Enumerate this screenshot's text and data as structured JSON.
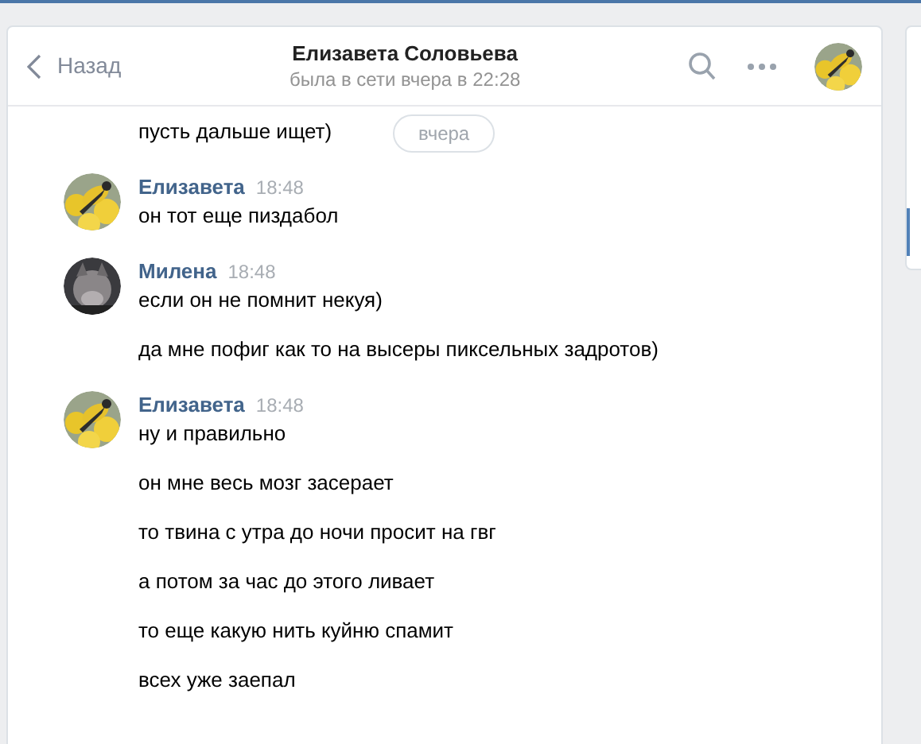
{
  "header": {
    "back": "Назад",
    "title": "Елизавета Соловьева",
    "status": "была в сети вчера в 22:28",
    "avatar": {
      "kind": "picture"
    }
  },
  "continued_messages": [
    "пусть дальше ищет)"
  ],
  "date_divider": "вчера",
  "groups": [
    {
      "sender": "Елизавета",
      "time": "18:48",
      "avatar": {
        "kind": "picture"
      },
      "messages": [
        "он тот еще пиздабол"
      ]
    },
    {
      "sender": "Милена",
      "time": "18:48",
      "avatar": {
        "kind": "picture"
      },
      "messages": [
        "если он не помнит некуя)",
        "да мне пофиг как то на высеры пиксельных задротов)"
      ]
    },
    {
      "sender": "Елизавета",
      "time": "18:48",
      "avatar": {
        "kind": "picture"
      },
      "messages": [
        "ну и правильно",
        "он мне весь мозг засерает",
        "то твина с утра до ночи просит на гвг",
        "а потом за час до этого ливает",
        "то еще какую нить куйню спамит",
        "всех уже заепал"
      ]
    }
  ]
}
